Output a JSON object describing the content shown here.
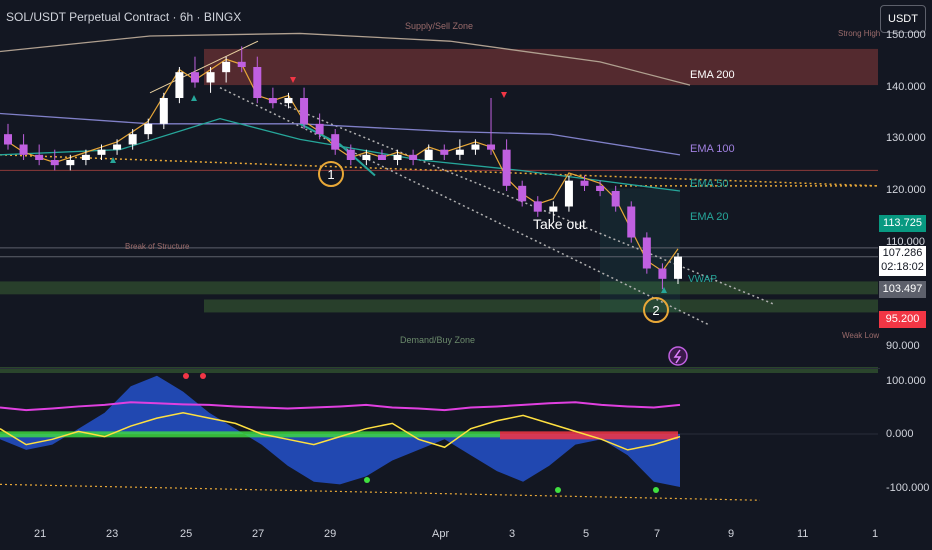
{
  "header": {
    "title": "SOL/USDT Perpetual Contract · 6h · BINGX",
    "currency_button": "USDT"
  },
  "price_axis": {
    "ticks": [
      "150.000",
      "140.000",
      "130.000",
      "120.000",
      "110.000",
      "90.000"
    ],
    "current_price": "107.286",
    "countdown": "02:18:02",
    "box_green": "113.725",
    "box_gray": "103.497",
    "box_red": "95.200",
    "oscillator_ticks": [
      "100.000",
      "0.000",
      "-100.000"
    ]
  },
  "time_axis": {
    "ticks": [
      "21",
      "23",
      "25",
      "27",
      "29",
      "Apr",
      "3",
      "5",
      "7",
      "9",
      "11",
      "1"
    ]
  },
  "annotations": {
    "ema_200": "EMA 200",
    "ema_100": "EMA 100",
    "ema_50": "EMA 50",
    "ema_20": "EMA 20",
    "vwap": "VWAP",
    "supply_zone": "Supply/Sell Zone",
    "demand_zone": "Demand/Buy Zone",
    "take_out": "Take out",
    "point_1": "1",
    "point_2": "2",
    "strong_high": "Strong High",
    "weak_low": "Weak Low",
    "break_of_structure": "Break of Structure"
  },
  "colors": {
    "background": "#131722",
    "bull_candle": "#ffffff",
    "bear_candle": "#c060e0",
    "supply_zone": "#8b3a3a",
    "demand_zone": "#2e4a2e",
    "ema200": "#b0a090",
    "ema100": "#8080c8",
    "ema50": "#26a69a",
    "ema20": "#e8a838",
    "osc_magenta": "#e040e0",
    "osc_yellow": "#ffe040",
    "osc_blue": "#2962ff",
    "osc_green": "#40e040",
    "osc_red": "#f23645",
    "circle": "#e8a838"
  },
  "chart_data": [
    {
      "type": "candlestick",
      "title": "SOL/USDT Perpetual Contract · 6h · BINGX",
      "ylim": [
        87,
        152
      ],
      "x_ticks": [
        "21",
        "23",
        "25",
        "27",
        "29",
        "Apr",
        "3",
        "5",
        "7",
        "9",
        "11",
        "1"
      ],
      "y_ticks": [
        150,
        140,
        130,
        120,
        110,
        90
      ],
      "candles": [
        {
          "o": 131,
          "h": 133,
          "l": 128,
          "c": 129
        },
        {
          "o": 129,
          "h": 131,
          "l": 126,
          "c": 127
        },
        {
          "o": 127,
          "h": 129,
          "l": 125,
          "c": 126
        },
        {
          "o": 126,
          "h": 128,
          "l": 124,
          "c": 125
        },
        {
          "o": 125,
          "h": 127,
          "l": 124,
          "c": 126
        },
        {
          "o": 126,
          "h": 128,
          "l": 125,
          "c": 127
        },
        {
          "o": 127,
          "h": 129,
          "l": 126,
          "c": 128
        },
        {
          "o": 128,
          "h": 130,
          "l": 127,
          "c": 129
        },
        {
          "o": 129,
          "h": 132,
          "l": 128,
          "c": 131
        },
        {
          "o": 131,
          "h": 134,
          "l": 130,
          "c": 133
        },
        {
          "o": 133,
          "h": 139,
          "l": 132,
          "c": 138
        },
        {
          "o": 138,
          "h": 144,
          "l": 137,
          "c": 143
        },
        {
          "o": 143,
          "h": 146,
          "l": 140,
          "c": 141
        },
        {
          "o": 141,
          "h": 144,
          "l": 139,
          "c": 143
        },
        {
          "o": 143,
          "h": 146,
          "l": 141,
          "c": 145
        },
        {
          "o": 145,
          "h": 148,
          "l": 143,
          "c": 144
        },
        {
          "o": 144,
          "h": 146,
          "l": 137,
          "c": 138
        },
        {
          "o": 138,
          "h": 140,
          "l": 136,
          "c": 137
        },
        {
          "o": 137,
          "h": 139,
          "l": 136,
          "c": 138
        },
        {
          "o": 138,
          "h": 140,
          "l": 132,
          "c": 133
        },
        {
          "o": 133,
          "h": 135,
          "l": 130,
          "c": 131
        },
        {
          "o": 131,
          "h": 132,
          "l": 127,
          "c": 128
        },
        {
          "o": 128,
          "h": 129,
          "l": 125,
          "c": 126
        },
        {
          "o": 126,
          "h": 128,
          "l": 125,
          "c": 127
        },
        {
          "o": 127,
          "h": 128,
          "l": 126,
          "c": 126
        },
        {
          "o": 126,
          "h": 128,
          "l": 125,
          "c": 127
        },
        {
          "o": 127,
          "h": 128,
          "l": 125,
          "c": 126
        },
        {
          "o": 126,
          "h": 129,
          "l": 126,
          "c": 128
        },
        {
          "o": 128,
          "h": 129,
          "l": 126,
          "c": 127
        },
        {
          "o": 127,
          "h": 130,
          "l": 126,
          "c": 128
        },
        {
          "o": 128,
          "h": 130,
          "l": 127,
          "c": 129
        },
        {
          "o": 129,
          "h": 138,
          "l": 127,
          "c": 128
        },
        {
          "o": 128,
          "h": 130,
          "l": 120,
          "c": 121
        },
        {
          "o": 121,
          "h": 122,
          "l": 117,
          "c": 118
        },
        {
          "o": 118,
          "h": 119,
          "l": 115,
          "c": 116
        },
        {
          "o": 116,
          "h": 118,
          "l": 114,
          "c": 117
        },
        {
          "o": 117,
          "h": 123,
          "l": 116,
          "c": 122
        },
        {
          "o": 122,
          "h": 123,
          "l": 120,
          "c": 121
        },
        {
          "o": 121,
          "h": 122,
          "l": 119,
          "c": 120
        },
        {
          "o": 120,
          "h": 121,
          "l": 116,
          "c": 117
        },
        {
          "o": 117,
          "h": 118,
          "l": 110,
          "c": 111
        },
        {
          "o": 111,
          "h": 112,
          "l": 104,
          "c": 105
        },
        {
          "o": 105,
          "h": 106,
          "l": 101,
          "c": 103
        },
        {
          "o": 103,
          "h": 108,
          "l": 102,
          "c": 107.3
        }
      ],
      "levels": {
        "current": 107.286,
        "ema20_value": 113.725,
        "vwap_value": 103.497,
        "low_marker": 95.2
      }
    },
    {
      "type": "area",
      "ylim": [
        -110,
        120
      ],
      "y_ticks": [
        100,
        0,
        -100
      ],
      "series": [
        {
          "values": [
            -10,
            -30,
            -20,
            10,
            40,
            90,
            110,
            80,
            40,
            10,
            -20,
            -60,
            -90,
            -95,
            -80,
            -50,
            -30,
            -10,
            -40,
            -70,
            -90,
            -60,
            -20,
            -10,
            -40,
            -90,
            -100
          ]
        },
        {
          "values": [
            50,
            45,
            48,
            52,
            55,
            60,
            58,
            56,
            55,
            52,
            50,
            48,
            50,
            52,
            55,
            50,
            48,
            45,
            50,
            52,
            55,
            58,
            60,
            55,
            52,
            50,
            55
          ]
        },
        {
          "values": [
            10,
            -20,
            -10,
            5,
            -5,
            15,
            30,
            40,
            30,
            20,
            0,
            -10,
            -20,
            -5,
            10,
            20,
            -10,
            -25,
            10,
            25,
            35,
            20,
            5,
            -10,
            -30,
            -20,
            -5
          ]
        }
      ]
    }
  ]
}
